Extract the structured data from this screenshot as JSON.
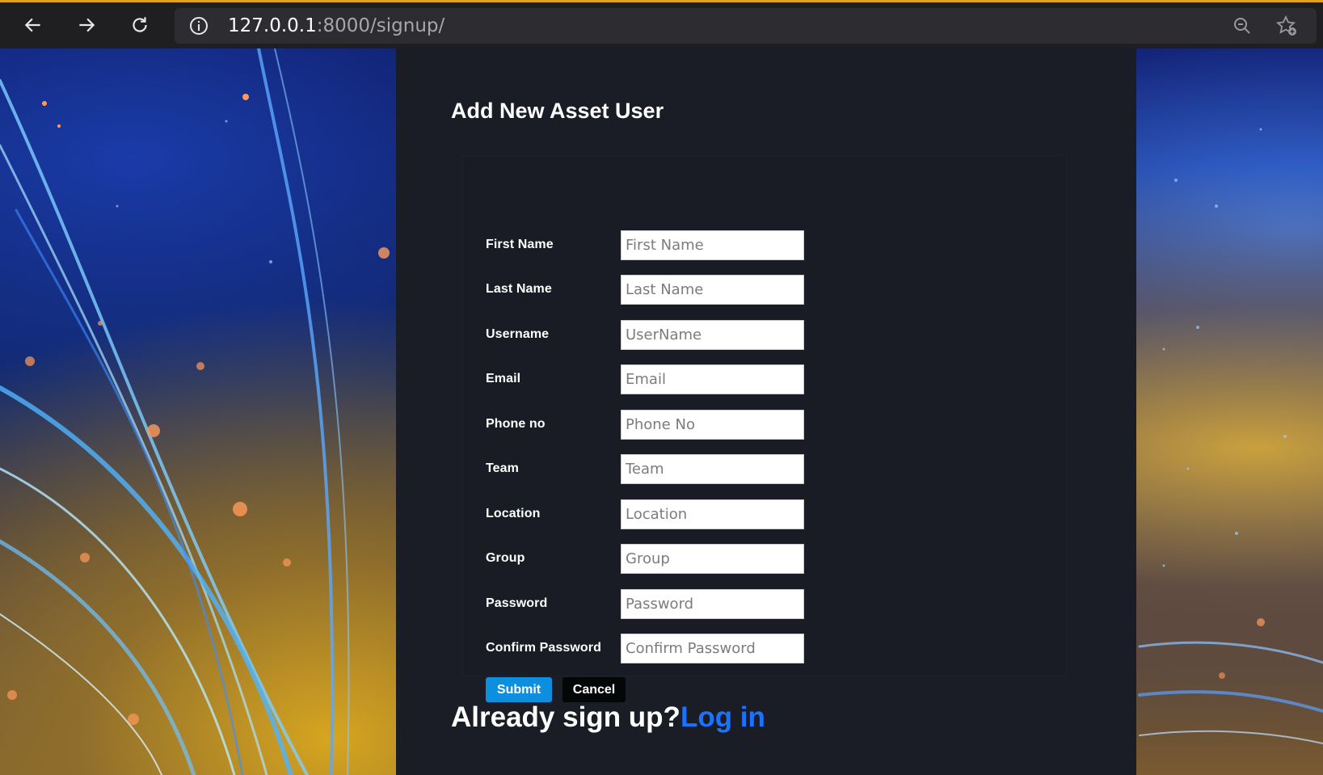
{
  "browser": {
    "url_host": "127.0.0.1",
    "url_rest": ":8000/signup/"
  },
  "page": {
    "title": "Add New Asset User"
  },
  "form": {
    "fields": [
      {
        "label": "First Name",
        "placeholder": "First Name"
      },
      {
        "label": "Last Name",
        "placeholder": "Last Name"
      },
      {
        "label": "Username",
        "placeholder": "UserName"
      },
      {
        "label": "Email",
        "placeholder": "Email"
      },
      {
        "label": "Phone no",
        "placeholder": "Phone No"
      },
      {
        "label": "Team",
        "placeholder": "Team"
      },
      {
        "label": "Location",
        "placeholder": "Location"
      },
      {
        "label": "Group",
        "placeholder": "Group"
      },
      {
        "label": "Password",
        "placeholder": "Password"
      },
      {
        "label": "Confirm Password",
        "placeholder": "Confirm Password"
      }
    ],
    "submit_label": "Submit",
    "cancel_label": "Cancel"
  },
  "footer": {
    "prompt": "Already sign up?",
    "link": "Log in"
  },
  "colors": {
    "panel_bg": "#1a1d25",
    "submit_bg": "#0d8fe0",
    "link": "#1a73ff"
  }
}
